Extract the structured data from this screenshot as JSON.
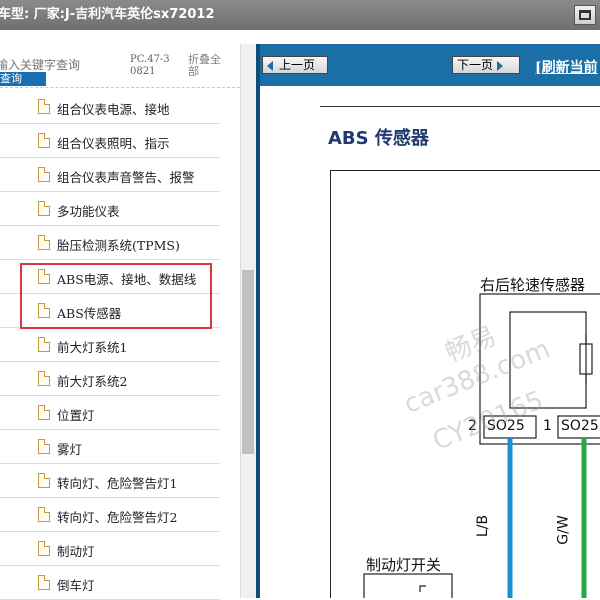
{
  "window": {
    "title": "车型: 厂家:J-吉利汽车英伦sx72012"
  },
  "search": {
    "placeholder": "输入关键字查询",
    "button_label": "查询",
    "code": "PC.47-30821",
    "collapse_label": "折叠全部"
  },
  "tree": {
    "items": [
      {
        "label": "组合仪表电源、接地"
      },
      {
        "label": "组合仪表照明、指示"
      },
      {
        "label": "组合仪表声音警告、报警"
      },
      {
        "label": "多功能仪表"
      },
      {
        "label": "胎压检测系统(TPMS)"
      },
      {
        "label": "ABS电源、接地、数据线"
      },
      {
        "label": "ABS传感器"
      },
      {
        "label": "前大灯系统1"
      },
      {
        "label": "前大灯系统2"
      },
      {
        "label": "位置灯"
      },
      {
        "label": "雾灯"
      },
      {
        "label": "转向灯、危险警告灯1"
      },
      {
        "label": "转向灯、危险警告灯2"
      },
      {
        "label": "制动灯"
      },
      {
        "label": "倒车灯"
      }
    ]
  },
  "nav": {
    "prev_label": "上一页",
    "next_label": "下一页",
    "refresh_label": "[刷新当前"
  },
  "document": {
    "title": "ABS 传感器",
    "sensor_label": "右后轮速传感器",
    "pin2": "2",
    "pin1": "1",
    "conn_a": "SO25",
    "conn_b": "SO25",
    "wire_lb": "L/B",
    "wire_gw": "G/W",
    "brake_switch": "制动灯开关"
  },
  "watermark": {
    "line1": "畅易",
    "line2": "car388.com",
    "line3": "CY20165"
  },
  "colors": {
    "navbar": "#1a6fa7",
    "highlight": "#d9363e",
    "doc_title": "#1f3a6e",
    "wire_blue": "#1b8fd6",
    "wire_green": "#27a844"
  }
}
